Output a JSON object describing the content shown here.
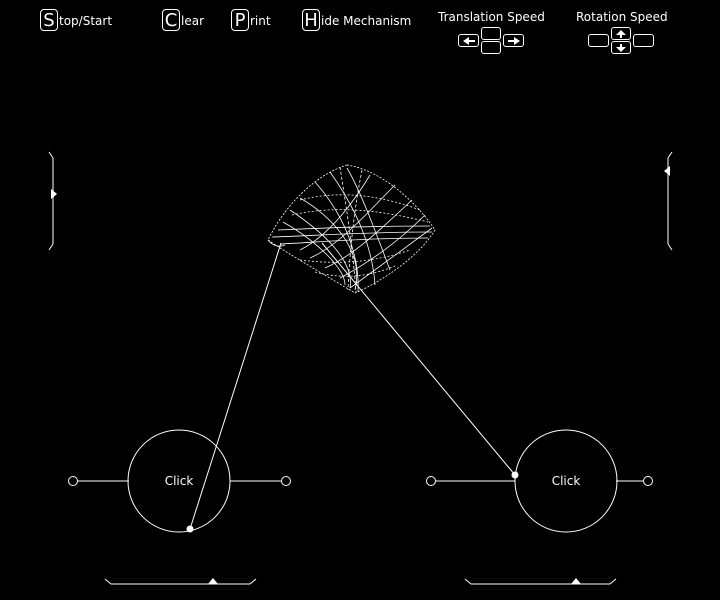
{
  "menu": {
    "stop_start": {
      "key": "S",
      "rest": "top/Start"
    },
    "clear": {
      "key": "C",
      "rest": "lear"
    },
    "print": {
      "key": "P",
      "rest": "rint"
    },
    "hide": {
      "key": "H",
      "rest": "ide Mechanism"
    }
  },
  "speed": {
    "translation_label": "Translation Speed",
    "rotation_label": "Rotation Speed"
  },
  "wheels": {
    "left_label": "Click",
    "right_label": "Click"
  }
}
